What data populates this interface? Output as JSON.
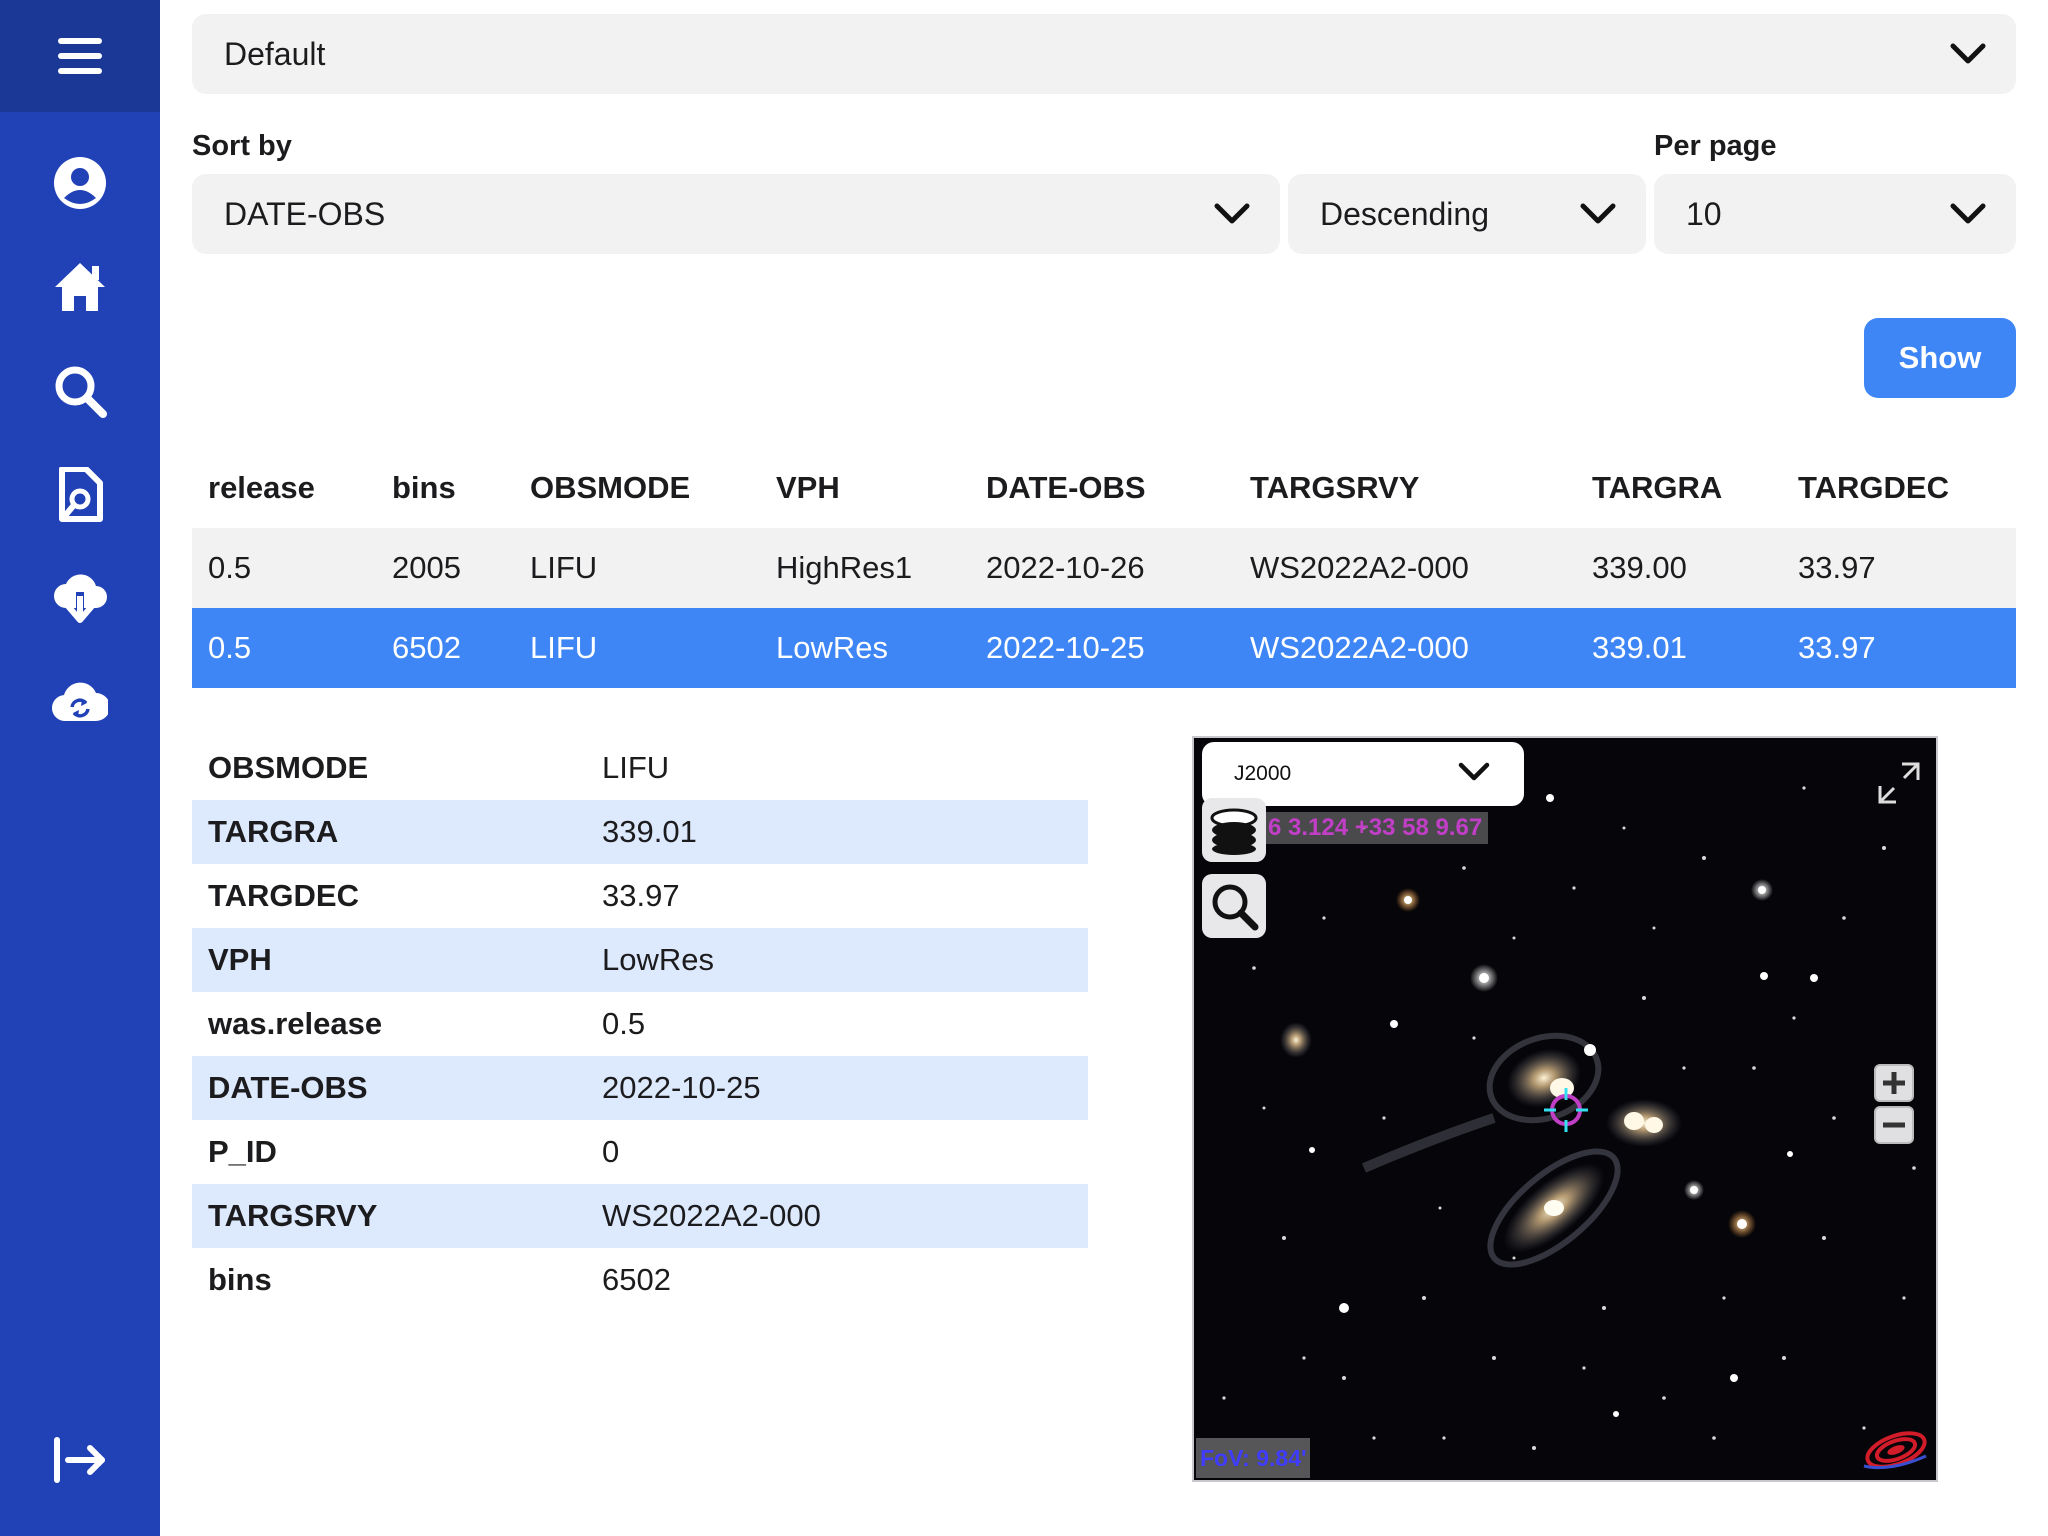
{
  "sidebar": {
    "icons": [
      "menu-icon",
      "user-icon",
      "home-icon",
      "search-icon",
      "file-search-icon",
      "cloud-download-icon",
      "cloud-sync-icon",
      "logout-icon"
    ]
  },
  "filters": {
    "preset_value": "Default",
    "sort_by_label": "Sort by",
    "sort_field_value": "DATE-OBS",
    "sort_order_value": "Descending",
    "per_page_label": "Per page",
    "per_page_value": "10",
    "show_label": "Show"
  },
  "results": {
    "columns": [
      "release",
      "bins",
      "OBSMODE",
      "VPH",
      "DATE-OBS",
      "TARGSRVY",
      "TARGRA",
      "TARGDEC"
    ],
    "rows": [
      [
        "0.5",
        "2005",
        "LIFU",
        "HighRes1",
        "2022-10-26",
        "WS2022A2-000",
        "339.00",
        "33.97"
      ],
      [
        "0.5",
        "6502",
        "LIFU",
        "LowRes",
        "2022-10-25",
        "WS2022A2-000",
        "339.01",
        "33.97"
      ]
    ],
    "selected_row": 1
  },
  "detail": {
    "rows": [
      {
        "key": "OBSMODE",
        "value": "LIFU"
      },
      {
        "key": "TARGRA",
        "value": "339.01"
      },
      {
        "key": "TARGDEC",
        "value": "33.97"
      },
      {
        "key": "VPH",
        "value": "LowRes"
      },
      {
        "key": "was.release",
        "value": "0.5"
      },
      {
        "key": "DATE-OBS",
        "value": "2022-10-25"
      },
      {
        "key": "P_ID",
        "value": "0"
      },
      {
        "key": "TARGSRVY",
        "value": "WS2022A2-000"
      },
      {
        "key": "bins",
        "value": "6502"
      }
    ]
  },
  "viewer": {
    "frame_value": "J2000",
    "coords_text": "6 3.124 +33 58 9.67",
    "fov_text": "FoV: 9.84'"
  },
  "colors": {
    "sidebar": "#2141b6",
    "sidebar_top": "#1c3896",
    "accent": "#3e86f5",
    "alt_row": "#dde9fd",
    "field_bg": "#f2f2f3",
    "reticle": "#c13ec6"
  }
}
